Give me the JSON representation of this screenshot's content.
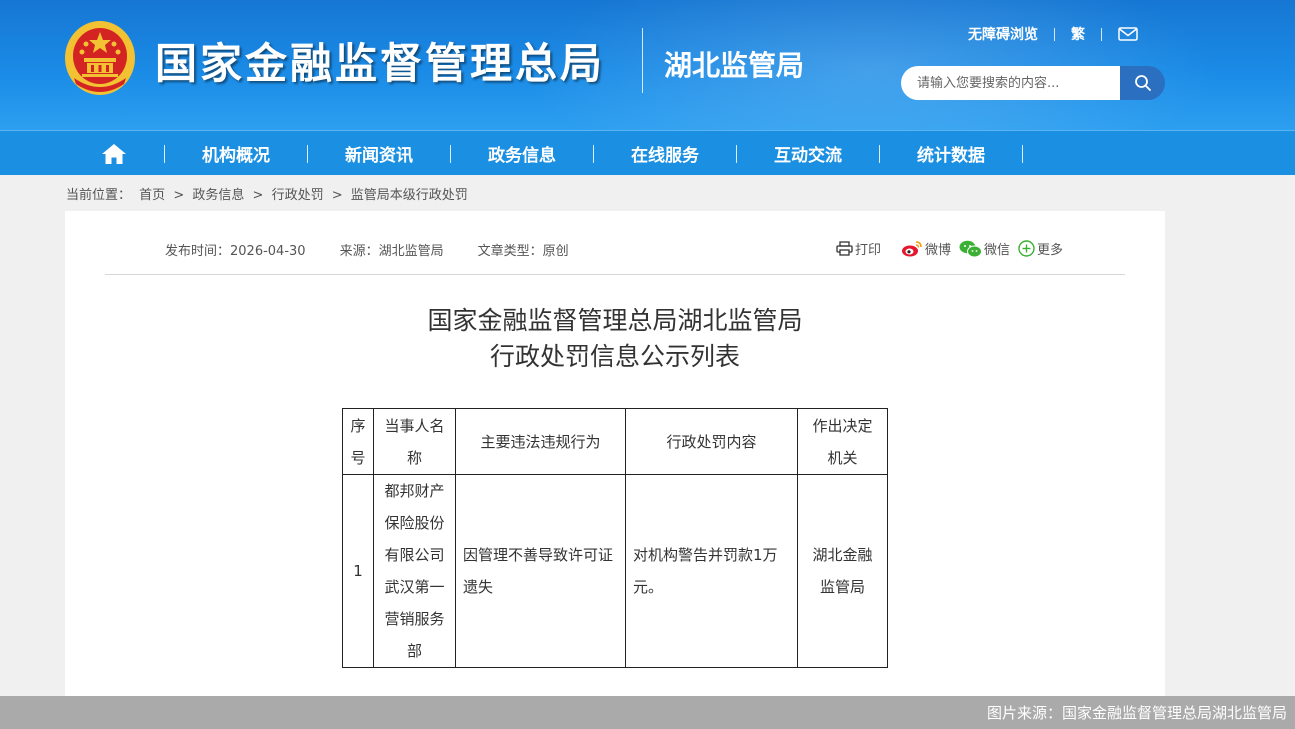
{
  "header": {
    "brand_title": "国家金融监督管理总局",
    "brand_sub": "湖北监管局",
    "toplinks": {
      "accessibility": "无障碍浏览",
      "traditional": "繁"
    },
    "search_placeholder": "请输入您要搜索的内容..."
  },
  "nav": {
    "items": [
      {
        "label": "机构概况"
      },
      {
        "label": "新闻资讯"
      },
      {
        "label": "政务信息"
      },
      {
        "label": "在线服务"
      },
      {
        "label": "互动交流"
      },
      {
        "label": "统计数据"
      }
    ]
  },
  "breadcrumb": {
    "prefix": "当前位置：",
    "items": [
      "首页",
      "政务信息",
      "行政处罚",
      "监管局本级行政处罚"
    ],
    "sep": ">"
  },
  "article": {
    "meta": {
      "publish": "发布时间：2026-04-30",
      "source": "来源：湖北监管局",
      "type": "文章类型：原创"
    },
    "share": {
      "print": "打印",
      "weibo": "微博",
      "wechat": "微信",
      "more": "更多"
    },
    "title_line1": "国家金融监督管理总局湖北监管局",
    "title_line2": "行政处罚信息公示列表"
  },
  "table": {
    "headers": [
      "序号",
      "当事人名称",
      "主要违法违规行为",
      "行政处罚内容",
      "作出决定机关"
    ],
    "rows": [
      {
        "index": "1",
        "party": "都邦财产保险股份有限公司武汉第一营销服务部",
        "violation": "因管理不善导致许可证遗失",
        "penalty": "对机构警告并罚款1万元。",
        "authority": "湖北金融监管局"
      }
    ]
  },
  "caption": "图片来源：国家金融监督管理总局湖北监管局",
  "colors": {
    "header_blue": "#1a8be6",
    "nav_blue": "#1b8fe2",
    "emblem_red": "#d42323",
    "emblem_gold": "#f2c232"
  }
}
